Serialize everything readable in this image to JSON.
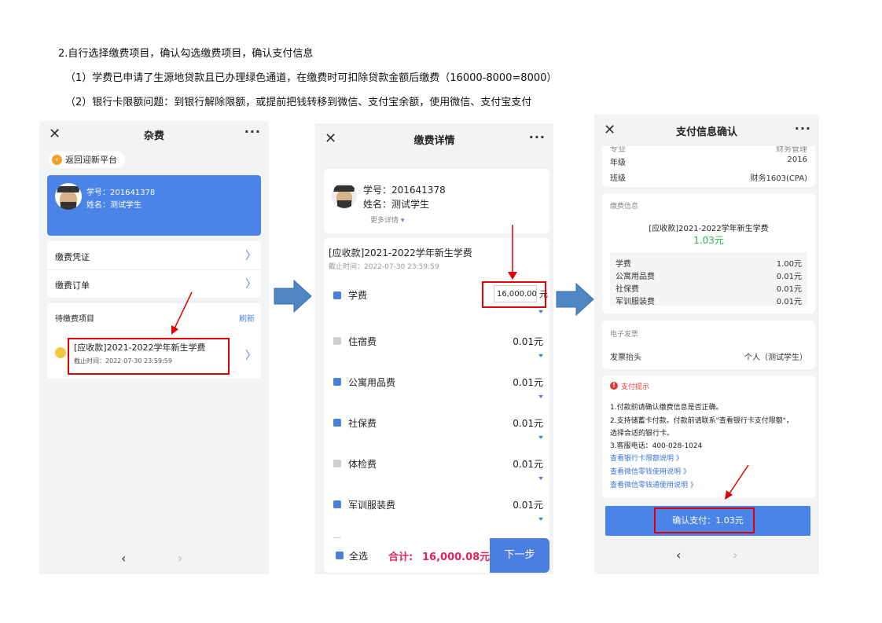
{
  "instructions": {
    "heading": "2.自行选择缴费项目，确认勾选缴费项目，确认支付信息",
    "note1": "（1）学费已申请了生源地贷款且已办理绿色通道，在缴费时可扣除贷款金额后缴费（16000-8000=8000）",
    "note2": "（2）银行卡限额问题：到银行解除限额，或提前把钱转移到微信、支付宝余额，使用微信、支付宝支付"
  },
  "phone1": {
    "title": "杂费",
    "back_label": "返回迎新平台",
    "student_id": "学号：201641378",
    "student_name": "姓名：测试学生",
    "menu": [
      {
        "label": "缴费凭证"
      },
      {
        "label": "缴费订单"
      }
    ],
    "pending_label": "待缴费项目",
    "refresh_label": "刷新",
    "item_title": "[应收款]2021-2022学年新生学费",
    "item_deadline": "截止时间：2022-07-30 23:59:59"
  },
  "phone2": {
    "title": "缴费详情",
    "student_id": "学号：201641378",
    "student_name": "姓名：测试学生",
    "more_details": "更多详情",
    "bill_title": "[应收款]2021-2022学年新生学费",
    "bill_deadline": "截止时间：2022-07-30 23:59:59",
    "items": [
      {
        "name": "学费",
        "amount": "16,000.00",
        "unit": "元",
        "checked": true
      },
      {
        "name": "住宿费",
        "amount": "0.01元",
        "checked": false
      },
      {
        "name": "公寓用品费",
        "amount": "0.01元",
        "checked": true
      },
      {
        "name": "社保费",
        "amount": "0.01元",
        "checked": true
      },
      {
        "name": "体检费",
        "amount": "0.01元",
        "checked": false
      },
      {
        "name": "军训服装费",
        "amount": "0.01元",
        "checked": true
      }
    ],
    "select_all": "全选",
    "total_label": "合计:",
    "total_value": "16,000.08元",
    "next_button": "下一步"
  },
  "phone3": {
    "title": "支付信息确认",
    "info_rows": [
      {
        "label": "专业",
        "value": "财务管理"
      },
      {
        "label": "年级",
        "value": "2016"
      },
      {
        "label": "班级",
        "value": "财务1603(CPA)"
      }
    ],
    "fee_info_label": "缴费信息",
    "fee_title": "[应收款]2021-2022学年新生学费",
    "fee_amount": "1.03元",
    "fee_items": [
      {
        "name": "学费",
        "value": "1.00元"
      },
      {
        "name": "公寓用品费",
        "value": "0.01元"
      },
      {
        "name": "社保费",
        "value": "0.01元"
      },
      {
        "name": "军训服装费",
        "value": "0.01元"
      }
    ],
    "invoice_label": "电子发票",
    "invoice_head_label": "发票抬头",
    "invoice_head_value": "个人（测试学生）",
    "tip_title": "支付提示",
    "tips": [
      "1.付款前请确认缴费信息是否正确。",
      "2.支持储蓄卡付款。付款前请联系\"查看银行卡支付限额\"，",
      "选择合适的银行卡。",
      "3.客服电话：400-028-1024"
    ],
    "links": [
      "查看银行卡限额说明 》",
      "查看微信零钱使用说明 》",
      "查看微信零钱通使用说明 》"
    ],
    "confirm_button": "确认支付：1.03元"
  },
  "colors": {
    "accent_blue": "#4a7ee0",
    "highlight_red": "#e00000",
    "amount_green": "#2bb24c",
    "total_pink": "#e0245e"
  }
}
